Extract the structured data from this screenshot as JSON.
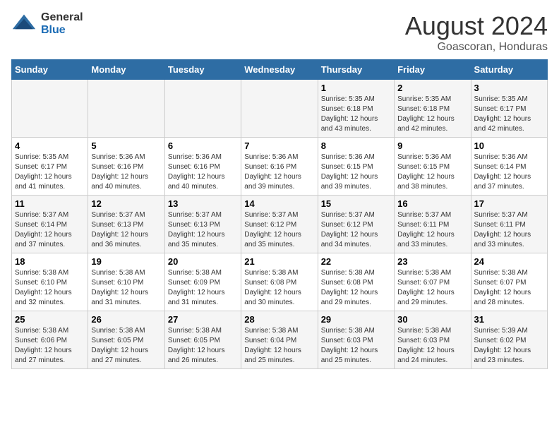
{
  "header": {
    "logo_general": "General",
    "logo_blue": "Blue",
    "month_year": "August 2024",
    "location": "Goascoran, Honduras"
  },
  "days_of_week": [
    "Sunday",
    "Monday",
    "Tuesday",
    "Wednesday",
    "Thursday",
    "Friday",
    "Saturday"
  ],
  "weeks": [
    [
      {
        "day": "",
        "info": ""
      },
      {
        "day": "",
        "info": ""
      },
      {
        "day": "",
        "info": ""
      },
      {
        "day": "",
        "info": ""
      },
      {
        "day": "1",
        "sunrise": "5:35 AM",
        "sunset": "6:18 PM",
        "daylight": "12 hours and 43 minutes."
      },
      {
        "day": "2",
        "sunrise": "5:35 AM",
        "sunset": "6:18 PM",
        "daylight": "12 hours and 42 minutes."
      },
      {
        "day": "3",
        "sunrise": "5:35 AM",
        "sunset": "6:17 PM",
        "daylight": "12 hours and 42 minutes."
      }
    ],
    [
      {
        "day": "4",
        "sunrise": "5:35 AM",
        "sunset": "6:17 PM",
        "daylight": "12 hours and 41 minutes."
      },
      {
        "day": "5",
        "sunrise": "5:36 AM",
        "sunset": "6:16 PM",
        "daylight": "12 hours and 40 minutes."
      },
      {
        "day": "6",
        "sunrise": "5:36 AM",
        "sunset": "6:16 PM",
        "daylight": "12 hours and 40 minutes."
      },
      {
        "day": "7",
        "sunrise": "5:36 AM",
        "sunset": "6:16 PM",
        "daylight": "12 hours and 39 minutes."
      },
      {
        "day": "8",
        "sunrise": "5:36 AM",
        "sunset": "6:15 PM",
        "daylight": "12 hours and 39 minutes."
      },
      {
        "day": "9",
        "sunrise": "5:36 AM",
        "sunset": "6:15 PM",
        "daylight": "12 hours and 38 minutes."
      },
      {
        "day": "10",
        "sunrise": "5:36 AM",
        "sunset": "6:14 PM",
        "daylight": "12 hours and 37 minutes."
      }
    ],
    [
      {
        "day": "11",
        "sunrise": "5:37 AM",
        "sunset": "6:14 PM",
        "daylight": "12 hours and 37 minutes."
      },
      {
        "day": "12",
        "sunrise": "5:37 AM",
        "sunset": "6:13 PM",
        "daylight": "12 hours and 36 minutes."
      },
      {
        "day": "13",
        "sunrise": "5:37 AM",
        "sunset": "6:13 PM",
        "daylight": "12 hours and 35 minutes."
      },
      {
        "day": "14",
        "sunrise": "5:37 AM",
        "sunset": "6:12 PM",
        "daylight": "12 hours and 35 minutes."
      },
      {
        "day": "15",
        "sunrise": "5:37 AM",
        "sunset": "6:12 PM",
        "daylight": "12 hours and 34 minutes."
      },
      {
        "day": "16",
        "sunrise": "5:37 AM",
        "sunset": "6:11 PM",
        "daylight": "12 hours and 33 minutes."
      },
      {
        "day": "17",
        "sunrise": "5:37 AM",
        "sunset": "6:11 PM",
        "daylight": "12 hours and 33 minutes."
      }
    ],
    [
      {
        "day": "18",
        "sunrise": "5:38 AM",
        "sunset": "6:10 PM",
        "daylight": "12 hours and 32 minutes."
      },
      {
        "day": "19",
        "sunrise": "5:38 AM",
        "sunset": "6:10 PM",
        "daylight": "12 hours and 31 minutes."
      },
      {
        "day": "20",
        "sunrise": "5:38 AM",
        "sunset": "6:09 PM",
        "daylight": "12 hours and 31 minutes."
      },
      {
        "day": "21",
        "sunrise": "5:38 AM",
        "sunset": "6:08 PM",
        "daylight": "12 hours and 30 minutes."
      },
      {
        "day": "22",
        "sunrise": "5:38 AM",
        "sunset": "6:08 PM",
        "daylight": "12 hours and 29 minutes."
      },
      {
        "day": "23",
        "sunrise": "5:38 AM",
        "sunset": "6:07 PM",
        "daylight": "12 hours and 29 minutes."
      },
      {
        "day": "24",
        "sunrise": "5:38 AM",
        "sunset": "6:07 PM",
        "daylight": "12 hours and 28 minutes."
      }
    ],
    [
      {
        "day": "25",
        "sunrise": "5:38 AM",
        "sunset": "6:06 PM",
        "daylight": "12 hours and 27 minutes."
      },
      {
        "day": "26",
        "sunrise": "5:38 AM",
        "sunset": "6:05 PM",
        "daylight": "12 hours and 27 minutes."
      },
      {
        "day": "27",
        "sunrise": "5:38 AM",
        "sunset": "6:05 PM",
        "daylight": "12 hours and 26 minutes."
      },
      {
        "day": "28",
        "sunrise": "5:38 AM",
        "sunset": "6:04 PM",
        "daylight": "12 hours and 25 minutes."
      },
      {
        "day": "29",
        "sunrise": "5:38 AM",
        "sunset": "6:03 PM",
        "daylight": "12 hours and 25 minutes."
      },
      {
        "day": "30",
        "sunrise": "5:38 AM",
        "sunset": "6:03 PM",
        "daylight": "12 hours and 24 minutes."
      },
      {
        "day": "31",
        "sunrise": "5:39 AM",
        "sunset": "6:02 PM",
        "daylight": "12 hours and 23 minutes."
      }
    ]
  ],
  "labels": {
    "sunrise": "Sunrise:",
    "sunset": "Sunset:",
    "daylight": "Daylight:"
  }
}
